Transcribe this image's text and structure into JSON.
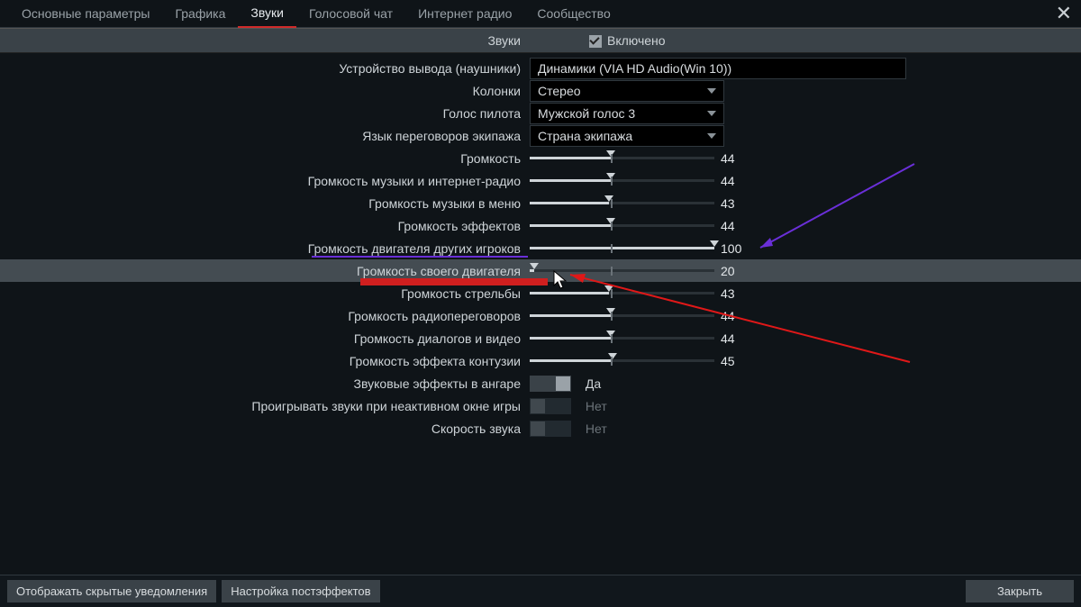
{
  "tabs": {
    "items": [
      "Основные параметры",
      "Графика",
      "Звуки",
      "Голосовой чат",
      "Интернет радио",
      "Сообщество"
    ],
    "active_index": 2
  },
  "header": {
    "sounds_label": "Звуки",
    "enabled_label": "Включено"
  },
  "rows": {
    "output_device": {
      "label": "Устройство вывода (наушники)",
      "value": "Динамики (VIA HD Audio(Win 10))"
    },
    "speakers": {
      "label": "Колонки",
      "value": "Стерео"
    },
    "pilot_voice": {
      "label": "Голос пилота",
      "value": "Мужской голос 3"
    },
    "crew_lang": {
      "label": "Язык переговоров экипажа",
      "value": "Страна экипажа"
    },
    "volume": {
      "label": "Громкость",
      "value": 44,
      "default": 44
    },
    "music_radio": {
      "label": "Громкость музыки и интернет-радио",
      "value": 44,
      "default": 44
    },
    "menu_music": {
      "label": "Громкость музыки в меню",
      "value": 43,
      "default": 44
    },
    "effects": {
      "label": "Громкость эффектов",
      "value": 44,
      "default": 44
    },
    "others_engine": {
      "label": "Громкость двигателя других игроков",
      "value": 100,
      "default": 44
    },
    "own_engine": {
      "label": "Громкость своего двигателя",
      "value": 20,
      "default": 44
    },
    "gunfire": {
      "label": "Громкость стрельбы",
      "value": 43,
      "default": 44
    },
    "radio": {
      "label": "Громкость радиопереговоров",
      "value": 44,
      "default": 44
    },
    "dialogs": {
      "label": "Громкость диалогов и видео",
      "value": 44,
      "default": 44
    },
    "contusion": {
      "label": "Громкость эффекта контузии",
      "value": 45,
      "default": 44
    },
    "hangar_fx": {
      "label": "Звуковые эффекты в ангаре",
      "value": "Да"
    },
    "inactive_audio": {
      "label": "Проигрывать звуки при неактивном окне игры",
      "value": "Нет"
    },
    "sound_speed": {
      "label": "Скорость звука",
      "value": "Нет"
    }
  },
  "footer": {
    "btn_hidden": "Отображать скрытые уведомления",
    "btn_postfx": "Настройка постэффектов",
    "btn_close": "Закрыть"
  }
}
